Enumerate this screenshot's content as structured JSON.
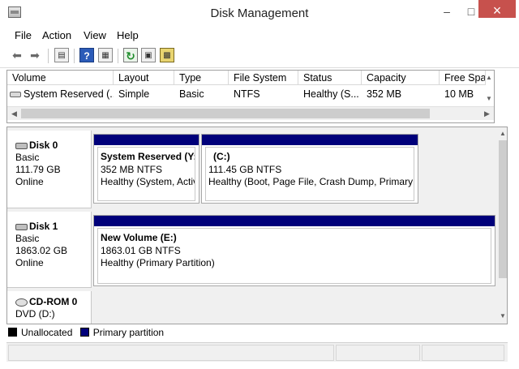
{
  "window": {
    "title": "Disk Management",
    "controls": {
      "minimize": "–",
      "maximize": "□",
      "close": "×"
    }
  },
  "menu": [
    "File",
    "Action",
    "View",
    "Help"
  ],
  "toolbar": {
    "icons": [
      "back-arrow-icon",
      "forward-arrow-icon",
      "show-hide-console-tree-icon",
      "help-icon",
      "properties-icon",
      "refresh-icon",
      "rescan-disks-icon",
      "settings-icon"
    ]
  },
  "volume_list": {
    "columns": [
      "Volume",
      "Layout",
      "Type",
      "File System",
      "Status",
      "Capacity",
      "Free Spa..."
    ],
    "rows": [
      {
        "volume": "System Reserved (...",
        "layout": "Simple",
        "type": "Basic",
        "file_system": "NTFS",
        "status": "Healthy (S...",
        "capacity": "352 MB",
        "free_space": "10 MB"
      }
    ]
  },
  "disks": [
    {
      "name": "Disk 0",
      "type": "Basic",
      "size": "111.79 GB",
      "state": "Online",
      "partitions": [
        {
          "name": "System Reserved  (Y:",
          "size": "352 MB NTFS",
          "status": "Healthy (System, Activ"
        },
        {
          "name": "(C:)",
          "size": "111.45 GB NTFS",
          "status": "Healthy (Boot, Page File, Crash Dump, Primary P"
        }
      ]
    },
    {
      "name": "Disk 1",
      "type": "Basic",
      "size": "1863.02 GB",
      "state": "Online",
      "partitions": [
        {
          "name": "New Volume  (E:)",
          "size": "1863.01 GB NTFS",
          "status": "Healthy (Primary Partition)"
        }
      ]
    },
    {
      "name": "CD-ROM 0",
      "type": "DVD (D:)"
    }
  ],
  "legend": [
    {
      "label": "Unallocated",
      "color": "#000000"
    },
    {
      "label": "Primary partition",
      "color": "#00007a"
    }
  ],
  "colors": {
    "partition_bar": "#00007a",
    "close_button": "#c7514d"
  }
}
